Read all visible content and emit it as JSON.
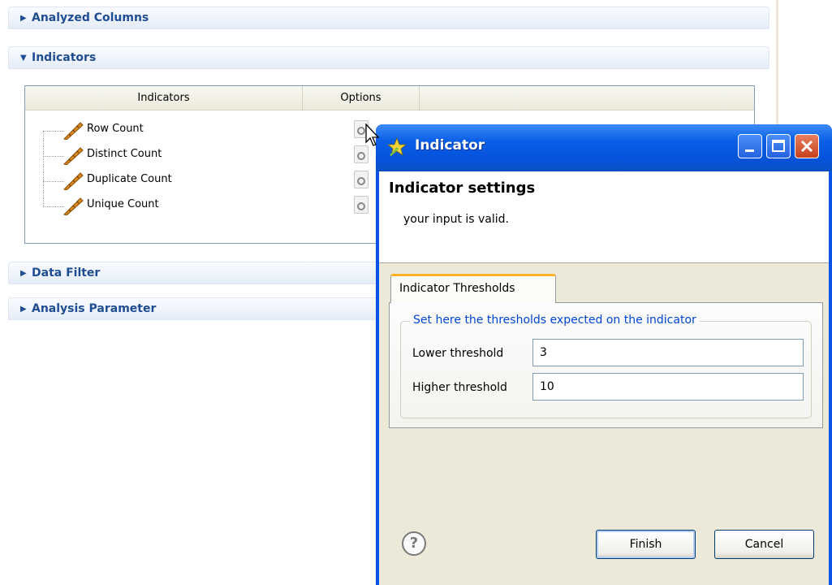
{
  "sections": {
    "analyzed_columns": "Analyzed Columns",
    "indicators": "Indicators",
    "data_filter": "Data Filter",
    "analysis_parameter": "Analysis Parameter"
  },
  "table": {
    "columns": [
      "Indicators",
      "Options"
    ],
    "rows": [
      {
        "label": "Row Count"
      },
      {
        "label": "Distinct Count"
      },
      {
        "label": "Duplicate Count"
      },
      {
        "label": "Unique Count"
      }
    ]
  },
  "dialog": {
    "title": "Indicator",
    "settings_title": "Indicator settings",
    "message": "your input is valid.",
    "tab_label": "Indicator Thresholds",
    "group_label": "Set here the thresholds expected on the indicator",
    "lower_label": "Lower threshold",
    "lower_value": "3",
    "higher_label": "Higher threshold",
    "higher_value": "10",
    "finish_label": "Finish",
    "cancel_label": "Cancel",
    "help_glyph": "?"
  },
  "colors": {
    "section_title": "#1f4d93",
    "titlebar": "#0a53e6",
    "tab_accent": "#ffb22a",
    "group_legend": "#0046d5"
  }
}
